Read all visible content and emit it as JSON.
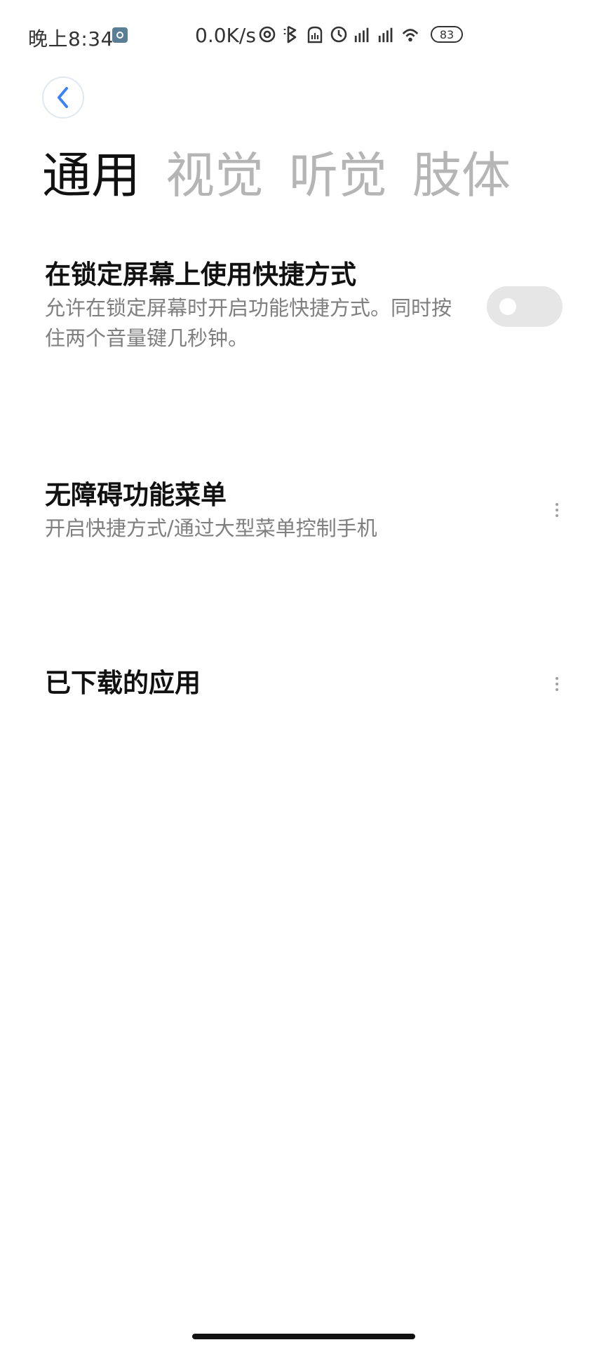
{
  "status_bar": {
    "time": "晚上8:34",
    "net_speed": "0.0K/s",
    "battery": "83",
    "icons": [
      "settings-notification-icon",
      "nfc-icon",
      "bluetooth-icon",
      "sim-icon",
      "alarm-icon",
      "signal-1-icon",
      "signal-2-icon",
      "wifi-icon"
    ]
  },
  "header": {
    "back_icon": "chevron-left-icon"
  },
  "tabs": [
    {
      "label": "通用",
      "active": true
    },
    {
      "label": "视觉",
      "active": false
    },
    {
      "label": "听觉",
      "active": false
    },
    {
      "label": "肢体",
      "active": false
    }
  ],
  "settings": [
    {
      "title": "在锁定屏幕上使用快捷方式",
      "description": "允许在锁定屏幕时开启功能快捷方式。同时按住两个音量键几秒钟。",
      "control": "toggle",
      "enabled": false
    },
    {
      "title": "无障碍功能菜单",
      "description": "开启快捷方式/通过大型菜单控制手机",
      "control": "more",
      "icon": "more-vertical-icon"
    },
    {
      "title": "已下载的应用",
      "control": "more",
      "icon": "more-vertical-icon"
    }
  ],
  "colors": {
    "accent": "#3b82f6",
    "active_tab": "#111111",
    "inactive_tab": "#b5b5b5",
    "toggle_off": "#e6e6e6",
    "description": "#7f7f7f"
  }
}
